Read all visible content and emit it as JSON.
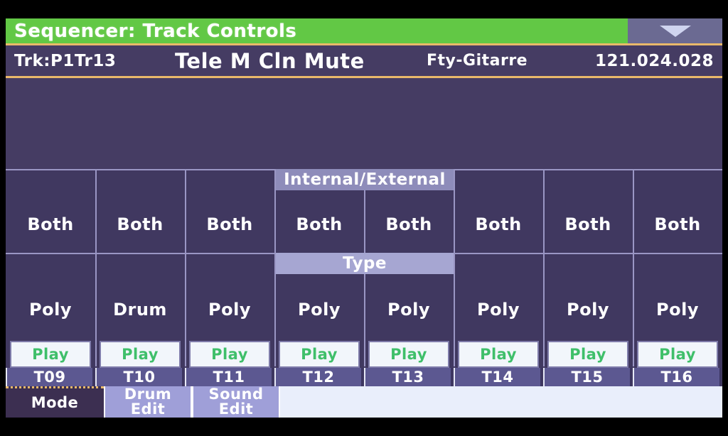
{
  "header": {
    "title": "Sequencer: Track Controls",
    "page_menu_icon": "chevron-down-icon",
    "title_bg": "#62c845",
    "menu_bg": "#6b6a92"
  },
  "track_info": {
    "track_label": "Trk:P1Tr13",
    "sound_name": "Tele M Cln Mute",
    "bank_name": "Fty-Gitarre",
    "position": "121.024.028",
    "divider_color": "#e9b96a"
  },
  "grid": {
    "section_labels": {
      "internal_external": "Internal/External",
      "type": "Type"
    },
    "columns": [
      {
        "tab": "T09",
        "internal_external": "Both",
        "type": "Poly",
        "play": "Play"
      },
      {
        "tab": "T10",
        "internal_external": "Both",
        "type": "Drum",
        "play": "Play"
      },
      {
        "tab": "T11",
        "internal_external": "Both",
        "type": "Poly",
        "play": "Play"
      },
      {
        "tab": "T12",
        "internal_external": "Both",
        "type": "Poly",
        "play": "Play"
      },
      {
        "tab": "T13",
        "internal_external": "Both",
        "type": "Poly",
        "play": "Play"
      },
      {
        "tab": "T14",
        "internal_external": "Both",
        "type": "Poly",
        "play": "Play"
      },
      {
        "tab": "T15",
        "internal_external": "Both",
        "type": "Poly",
        "play": "Play"
      },
      {
        "tab": "T16",
        "internal_external": "Both",
        "type": "Poly",
        "play": "Play"
      }
    ],
    "play_text_color": "#3fbf6a"
  },
  "bottom_tabs": [
    {
      "line1": "Mode",
      "line2": "",
      "selected": true
    },
    {
      "line1": "Drum",
      "line2": "Edit",
      "selected": false
    },
    {
      "line1": "Sound",
      "line2": "Edit",
      "selected": false
    }
  ],
  "colors": {
    "lcd_background": "#453c63",
    "grid_line": "#9a96c4",
    "accent_green": "#62c845",
    "accent_orange": "#e9b96a",
    "tab_selected": "#3c2f51",
    "tab_unselected": "#9f9fd8"
  }
}
